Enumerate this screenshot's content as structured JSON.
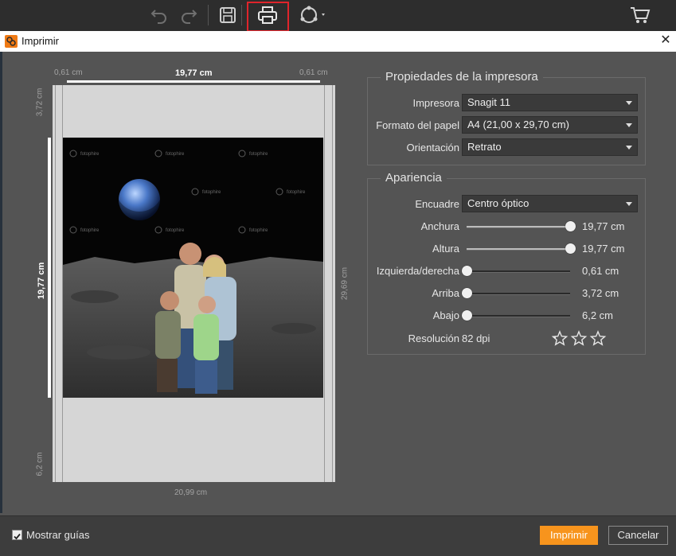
{
  "toolbar": {
    "icons": [
      "undo-icon",
      "redo-icon",
      "save-icon",
      "print-icon",
      "share-icon",
      "cart-icon"
    ]
  },
  "dialog": {
    "title": "Imprimir",
    "close": "✕"
  },
  "preview": {
    "margin_left_top": "0,61 cm",
    "width_top": "19,77 cm",
    "margin_right_top": "0,61 cm",
    "margin_top_side": "3,72 cm",
    "height_side": "19,77 cm",
    "paper_height": "29,69 cm",
    "margin_bottom_side": "6,2 cm",
    "paper_width": "20,99 cm",
    "watermark": "fotophire"
  },
  "printer_props": {
    "title": "Propiedades de la impresora",
    "printer_label": "Impresora",
    "printer_value": "Snagit 11",
    "paper_label": "Formato del papel",
    "paper_value": "A4 (21,00 x 29,70 cm)",
    "orientation_label": "Orientación",
    "orientation_value": "Retrato"
  },
  "appearance": {
    "title": "Apariencia",
    "frame_label": "Encuadre",
    "frame_value": "Centro óptico",
    "sliders": [
      {
        "label": "Anchura",
        "value": "19,77 cm",
        "level": 1.0
      },
      {
        "label": "Altura",
        "value": "19,77 cm",
        "level": 1.0
      },
      {
        "label": "Izquierda/derecha",
        "value": "0,61 cm",
        "level": 0.0
      },
      {
        "label": "Arriba",
        "value": "3,72 cm",
        "level": 0.0
      },
      {
        "label": "Abajo",
        "value": "6,2 cm",
        "level": 0.0
      }
    ],
    "resolution_label": "Resolución",
    "resolution_value": "82 dpi",
    "quality_stars": 0.5,
    "quality_max": 3
  },
  "footer": {
    "show_guides_label": "Mostrar guías",
    "show_guides_checked": true,
    "print_label": "Imprimir",
    "cancel_label": "Cancelar"
  },
  "colors": {
    "accent": "#f7941d",
    "highlight": "#e0242b"
  }
}
